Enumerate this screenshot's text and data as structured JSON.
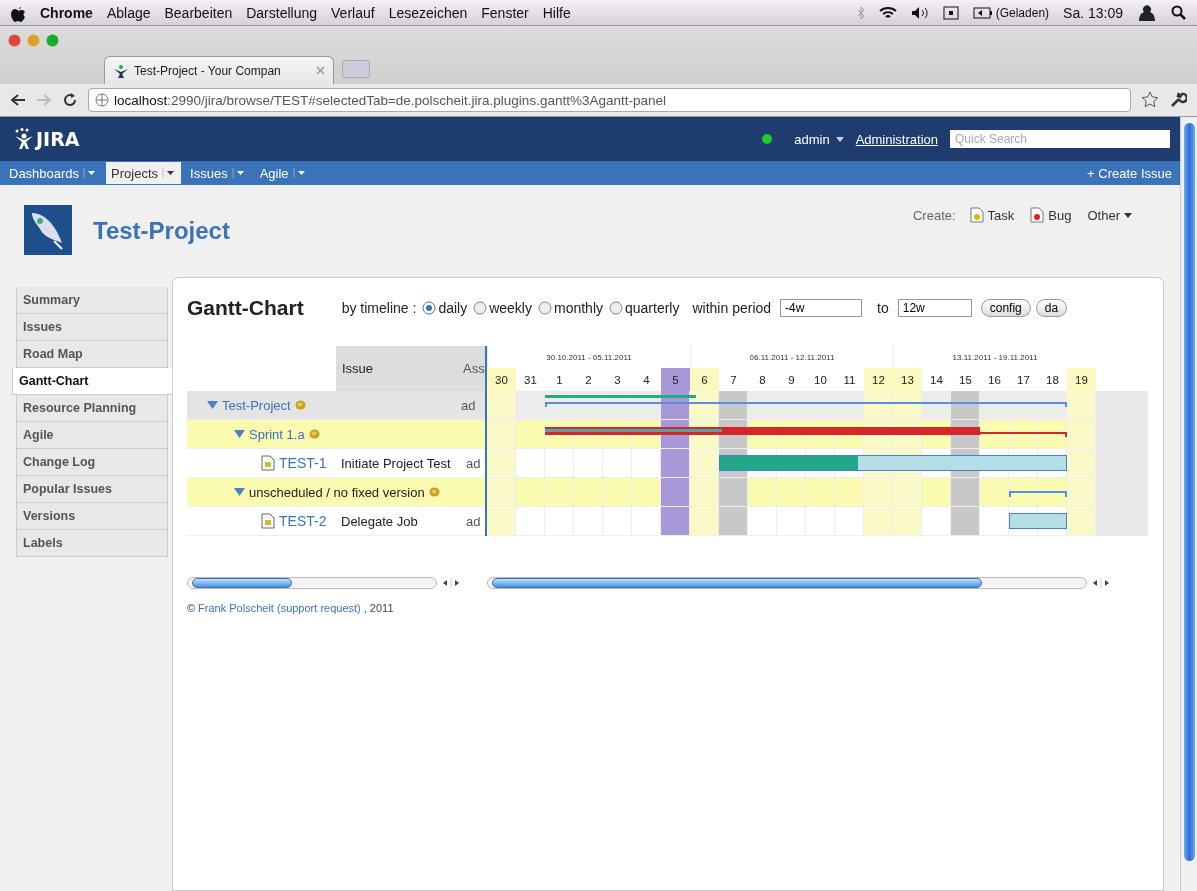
{
  "menubar": {
    "items": [
      "Chrome",
      "Ablage",
      "Bearbeiten",
      "Darstellung",
      "Verlauf",
      "Lesezeichen",
      "Fenster",
      "Hilfe"
    ],
    "battery": "(Geladen)",
    "clock": "Sa. 13:09"
  },
  "browser": {
    "tab_title": "Test-Project - Your Compan",
    "url_host": "localhost",
    "url_rest": ":2990/jira/browse/TEST#selectedTab=de.polscheit.jira.plugins.gantt%3Agantt-panel"
  },
  "header": {
    "logo": "JIRA",
    "user": "admin",
    "admin_link": "Administration",
    "search": {
      "placeholder": "Quick Search"
    },
    "nav": [
      {
        "label": "Dashboards",
        "selected": false
      },
      {
        "label": "Projects",
        "selected": true
      },
      {
        "label": "Issues",
        "selected": false
      },
      {
        "label": "Agile",
        "selected": false
      }
    ],
    "create_issue": "+ Create Issue"
  },
  "project": {
    "name": "Test-Project",
    "create_label": "Create:",
    "create_types": [
      {
        "label": "Task",
        "kind": "task"
      },
      {
        "label": "Bug",
        "kind": "bug"
      }
    ],
    "other": "Other"
  },
  "sidebar": {
    "items": [
      {
        "label": "Summary",
        "selected": false
      },
      {
        "label": "Issues",
        "selected": false
      },
      {
        "label": "Road Map",
        "selected": false
      },
      {
        "label": "Gantt-Chart",
        "selected": true
      },
      {
        "label": "Resource Planning",
        "selected": false
      },
      {
        "label": "Agile",
        "selected": false
      },
      {
        "label": "Change Log",
        "selected": false
      },
      {
        "label": "Popular Issues",
        "selected": false
      },
      {
        "label": "Versions",
        "selected": false
      },
      {
        "label": "Labels",
        "selected": false
      }
    ]
  },
  "gantt": {
    "title": "Gantt-Chart",
    "timeline_label": "by timeline :",
    "timelines": [
      {
        "label": "daily",
        "selected": true
      },
      {
        "label": "weekly",
        "selected": false
      },
      {
        "label": "monthly",
        "selected": false
      },
      {
        "label": "quarterly",
        "selected": false
      }
    ],
    "period_label": "within period",
    "period_from": "-4w",
    "to_label": "to",
    "period_to": "12w",
    "buttons": [
      "config",
      "da"
    ],
    "columns": [
      "Issue",
      "Ass"
    ],
    "weeks": [
      "30.10.2011  -  05.11.2011",
      "06.11.2011  -  12.11.2011",
      "13.11.2011  -  19.11.2011"
    ],
    "days": [
      {
        "label": "30",
        "kind": "weekend"
      },
      {
        "label": "31",
        "kind": "normal"
      },
      {
        "label": "1",
        "kind": "normal"
      },
      {
        "label": "2",
        "kind": "normal"
      },
      {
        "label": "3",
        "kind": "normal"
      },
      {
        "label": "4",
        "kind": "normal"
      },
      {
        "label": "5",
        "kind": "today"
      },
      {
        "label": "6",
        "kind": "weekend"
      },
      {
        "label": "7",
        "kind": "marked"
      },
      {
        "label": "8",
        "kind": "normal"
      },
      {
        "label": "9",
        "kind": "normal"
      },
      {
        "label": "10",
        "kind": "normal"
      },
      {
        "label": "11",
        "kind": "normal"
      },
      {
        "label": "12",
        "kind": "weekend"
      },
      {
        "label": "13",
        "kind": "weekend"
      },
      {
        "label": "14",
        "kind": "normal"
      },
      {
        "label": "15",
        "kind": "marked"
      },
      {
        "label": "16",
        "kind": "normal"
      },
      {
        "label": "17",
        "kind": "normal"
      },
      {
        "label": "18",
        "kind": "normal"
      },
      {
        "label": "19",
        "kind": "weekend"
      }
    ],
    "rows": [
      {
        "kind": "project",
        "name": "Test-Project",
        "assignee": "ad",
        "expanded": true,
        "bar": {
          "kind": "summary",
          "level": 0.29
        },
        "children": [
          {
            "kind": "version",
            "name": "Sprint 1.a",
            "expanded": true,
            "bar": {
              "kind": "version",
              "level": 0.34
            },
            "children": [
              {
                "kind": "issue",
                "key": "TEST-1",
                "summary": "Initiate Project Test",
                "assignee": "ad",
                "bar": {
                  "kind": "task",
                  "level": 0.4
                }
              }
            ]
          },
          {
            "kind": "version",
            "name": "unscheduled / no fixed version",
            "expanded": true,
            "bar": {
              "kind": "bracket"
            },
            "children": [
              {
                "kind": "issue",
                "key": "TEST-2",
                "summary": "Delegate Job",
                "assignee": "ad",
                "bar": {
                  "kind": "task"
                }
              }
            ]
          }
        ]
      }
    ],
    "footer": {
      "copyright": "©",
      "link": "Frank Polscheit (support request)",
      "suffix": ", 2011"
    }
  }
}
